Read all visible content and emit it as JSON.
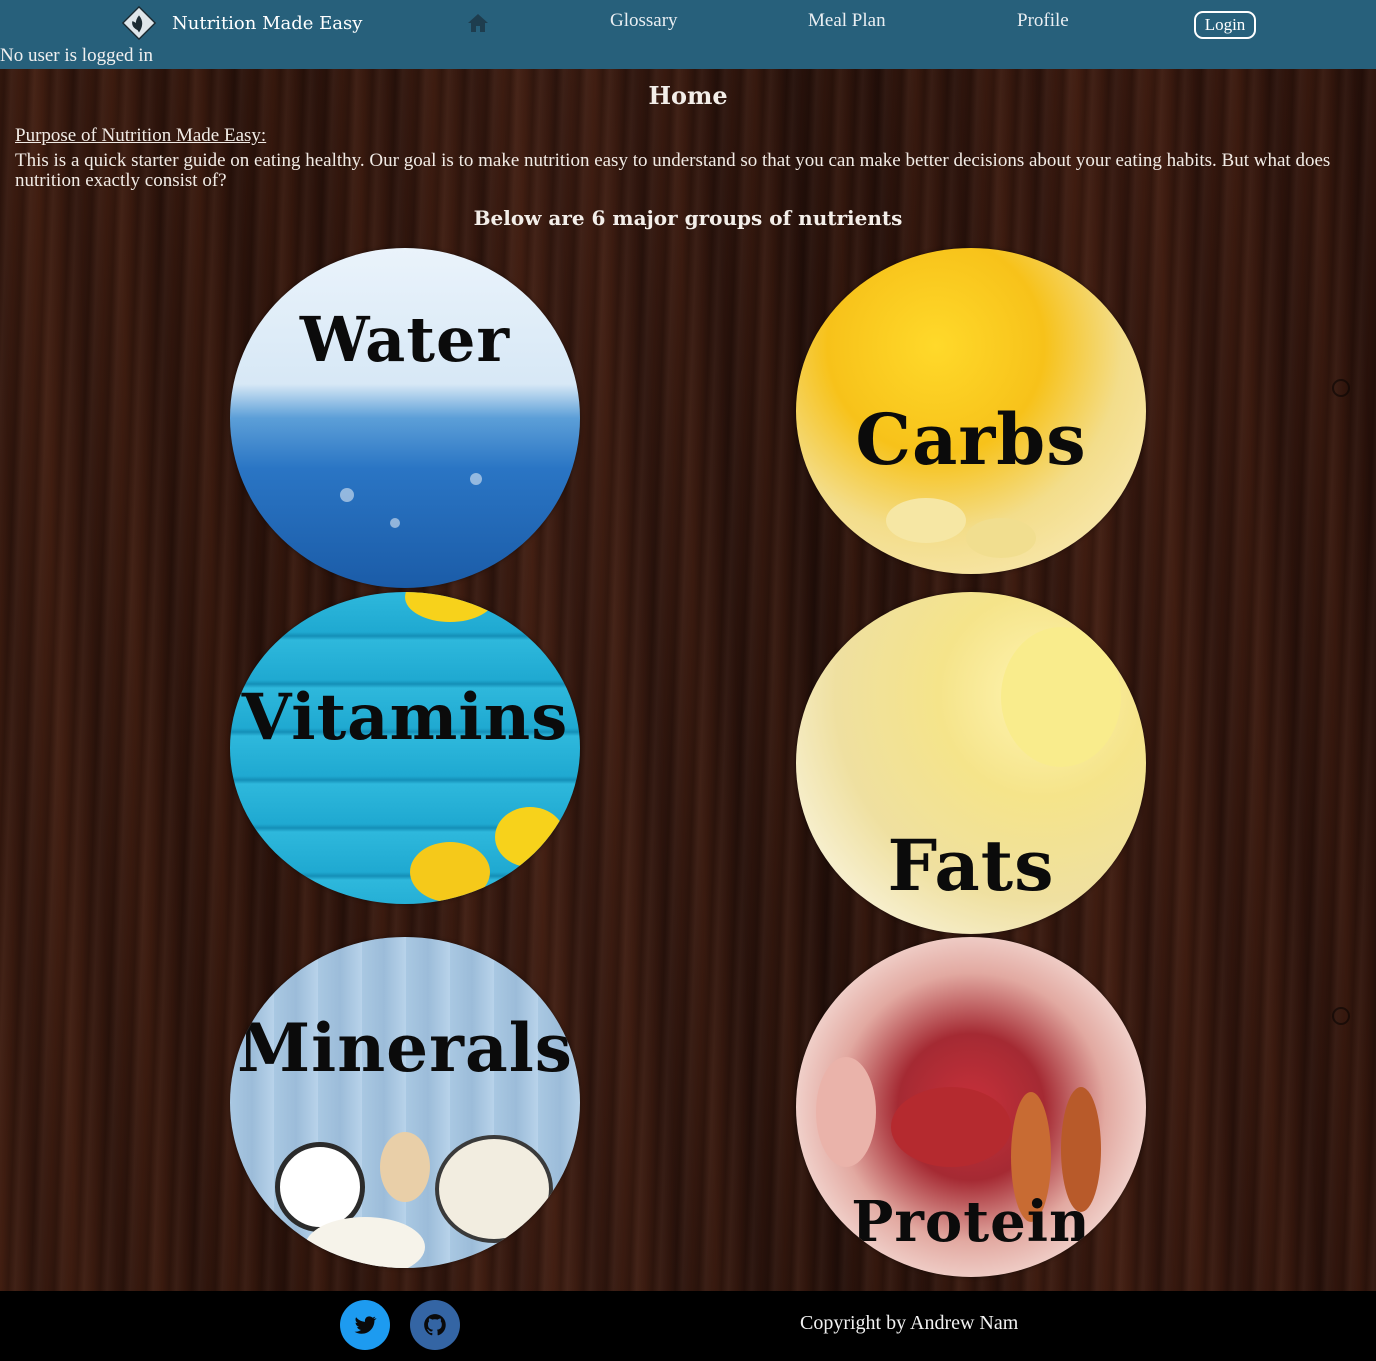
{
  "navbar": {
    "brand_name": "Nutrition Made Easy",
    "links": {
      "glossary": "Glossary",
      "meal_plan": "Meal Plan",
      "profile": "Profile"
    },
    "login_label": "Login",
    "home_icon": "home-icon",
    "logo_icon": "leaf-logo-icon",
    "background_color": "#27607b"
  },
  "user_status": "No user is logged in",
  "main": {
    "title": "Home",
    "purpose_heading": "Purpose of Nutrition Made Easy:",
    "purpose_text": "This is a quick starter guide on eating healthy. Our goal is to make nutrition easy to understand so that you can make better decisions about your eating habits. But what does nutrition exactly consist of?",
    "groups_heading": "Below are 6 major groups of nutrients",
    "nutrients": [
      {
        "label": "Water"
      },
      {
        "label": "Carbs"
      },
      {
        "label": "Vitamins"
      },
      {
        "label": "Fats"
      },
      {
        "label": "Minerals"
      },
      {
        "label": "Protein"
      }
    ]
  },
  "footer": {
    "social_icons": [
      "twitter-icon",
      "github-icon"
    ],
    "copyright": "Copyright by Andrew Nam"
  }
}
